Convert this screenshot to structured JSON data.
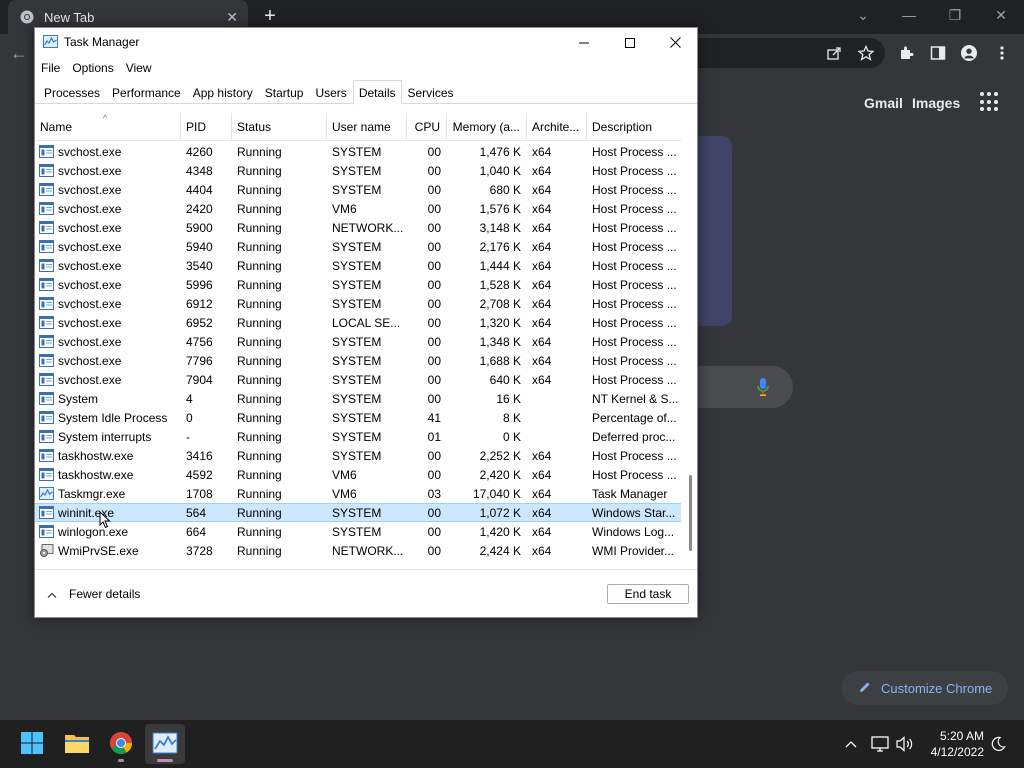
{
  "chrome": {
    "tab_title": "New Tab",
    "gmail": "Gmail",
    "images": "Images",
    "customize": "Customize Chrome"
  },
  "taskmgr": {
    "title": "Task Manager",
    "menu": [
      "File",
      "Options",
      "View"
    ],
    "tabs": [
      "Processes",
      "Performance",
      "App history",
      "Startup",
      "Users",
      "Details",
      "Services"
    ],
    "active_tab": "Details",
    "columns": [
      "Name",
      "PID",
      "Status",
      "User name",
      "CPU",
      "Memory (a...",
      "Archite...",
      "Description"
    ],
    "rows": [
      [
        "svchost.exe",
        "4260",
        "Running",
        "SYSTEM",
        "00",
        "1,476 K",
        "x64",
        "Host Process ..."
      ],
      [
        "svchost.exe",
        "4348",
        "Running",
        "SYSTEM",
        "00",
        "1,040 K",
        "x64",
        "Host Process ..."
      ],
      [
        "svchost.exe",
        "4404",
        "Running",
        "SYSTEM",
        "00",
        "680 K",
        "x64",
        "Host Process ..."
      ],
      [
        "svchost.exe",
        "2420",
        "Running",
        "VM6",
        "00",
        "1,576 K",
        "x64",
        "Host Process ..."
      ],
      [
        "svchost.exe",
        "5900",
        "Running",
        "NETWORK...",
        "00",
        "3,148 K",
        "x64",
        "Host Process ..."
      ],
      [
        "svchost.exe",
        "5940",
        "Running",
        "SYSTEM",
        "00",
        "2,176 K",
        "x64",
        "Host Process ..."
      ],
      [
        "svchost.exe",
        "3540",
        "Running",
        "SYSTEM",
        "00",
        "1,444 K",
        "x64",
        "Host Process ..."
      ],
      [
        "svchost.exe",
        "5996",
        "Running",
        "SYSTEM",
        "00",
        "1,528 K",
        "x64",
        "Host Process ..."
      ],
      [
        "svchost.exe",
        "6912",
        "Running",
        "SYSTEM",
        "00",
        "2,708 K",
        "x64",
        "Host Process ..."
      ],
      [
        "svchost.exe",
        "6952",
        "Running",
        "LOCAL SE...",
        "00",
        "1,320 K",
        "x64",
        "Host Process ..."
      ],
      [
        "svchost.exe",
        "4756",
        "Running",
        "SYSTEM",
        "00",
        "1,348 K",
        "x64",
        "Host Process ..."
      ],
      [
        "svchost.exe",
        "7796",
        "Running",
        "SYSTEM",
        "00",
        "1,688 K",
        "x64",
        "Host Process ..."
      ],
      [
        "svchost.exe",
        "7904",
        "Running",
        "SYSTEM",
        "00",
        "640 K",
        "x64",
        "Host Process ..."
      ],
      [
        "System",
        "4",
        "Running",
        "SYSTEM",
        "00",
        "16 K",
        "",
        "NT Kernel & S..."
      ],
      [
        "System Idle Process",
        "0",
        "Running",
        "SYSTEM",
        "41",
        "8 K",
        "",
        "Percentage of..."
      ],
      [
        "System interrupts",
        "-",
        "Running",
        "SYSTEM",
        "01",
        "0 K",
        "",
        "Deferred proc..."
      ],
      [
        "taskhostw.exe",
        "3416",
        "Running",
        "SYSTEM",
        "00",
        "2,252 K",
        "x64",
        "Host Process ..."
      ],
      [
        "taskhostw.exe",
        "4592",
        "Running",
        "VM6",
        "00",
        "2,420 K",
        "x64",
        "Host Process ..."
      ],
      [
        "Taskmgr.exe",
        "1708",
        "Running",
        "VM6",
        "03",
        "17,040 K",
        "x64",
        "Task Manager"
      ],
      [
        "wininit.exe",
        "564",
        "Running",
        "SYSTEM",
        "00",
        "1,072 K",
        "x64",
        "Windows Star..."
      ],
      [
        "winlogon.exe",
        "664",
        "Running",
        "SYSTEM",
        "00",
        "1,420 K",
        "x64",
        "Windows Log..."
      ],
      [
        "WmiPrvSE.exe",
        "3728",
        "Running",
        "NETWORK...",
        "00",
        "2,424 K",
        "x64",
        "WMI Provider..."
      ]
    ],
    "row_icons": [
      "service",
      "service",
      "service",
      "service",
      "service",
      "service",
      "service",
      "service",
      "service",
      "service",
      "service",
      "service",
      "service",
      "service",
      "service",
      "service",
      "service",
      "service",
      "taskmgr",
      "service",
      "service",
      "wmi"
    ],
    "selected_row": 19,
    "fewer_details": "Fewer details",
    "end_task": "End task"
  },
  "taskbar": {
    "time": "5:20 AM",
    "date": "4/12/2022"
  },
  "colors": {
    "selection": "#cce8ff",
    "chrome_bg": "#35363a",
    "accent_link": "#8ab4f8"
  }
}
